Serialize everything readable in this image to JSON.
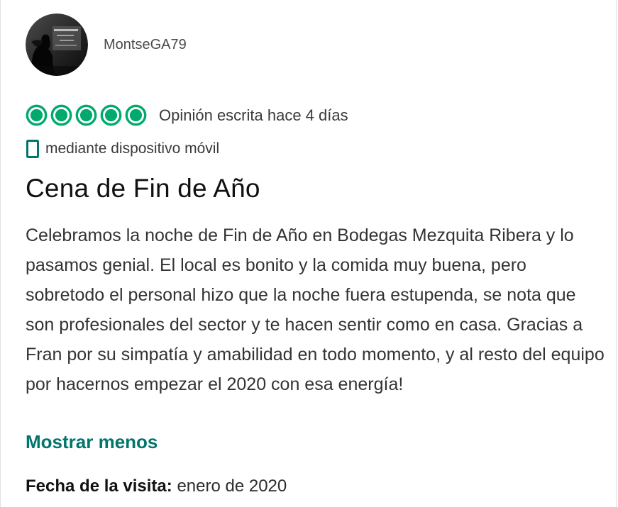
{
  "review": {
    "author": {
      "username": "MontseGA79",
      "avatar": "user-avatar-photo"
    },
    "rating": {
      "value": 5,
      "max": 5,
      "icon": "rating-bubble-icon",
      "color": "#00aa6c"
    },
    "written_date": "Opinión escrita hace 4 días",
    "device": {
      "icon": "mobile-phone-icon",
      "text": "mediante dispositivo móvil"
    },
    "title": "Cena de Fin de Año",
    "body": "Celebramos la noche de Fin de Año en Bodegas Mezquita Ribera y lo pasamos genial. El local es bonito y la comida muy buena, pero sobretodo el personal hizo que la noche fuera estupenda, se nota que son profesionales del sector y te hacen sentir como en casa. Gracias a Fran por su simpatía y amabilidad en todo momento, y al resto del equipo por hacernos empezar el 2020 con esa energía!",
    "show_less_label": "Mostrar menos",
    "visit": {
      "label": "Fecha de la visita:",
      "value": "enero de 2020"
    }
  },
  "colors": {
    "accent": "#00766c",
    "bubble_fill": "#00aa6c"
  }
}
